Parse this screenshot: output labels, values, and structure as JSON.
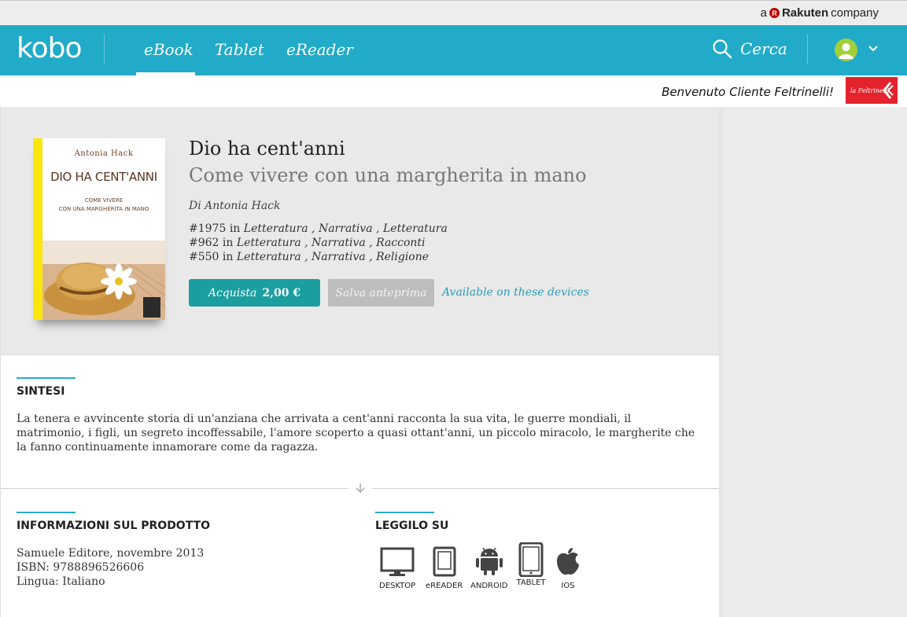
{
  "header": {
    "rakuten_prefix": "a",
    "rakuten_brand": "Rakuten",
    "rakuten_suffix": "company"
  },
  "nav": {
    "logo": "kobo",
    "tabs": [
      {
        "label": "eBook",
        "active": true
      },
      {
        "label": "Tablet",
        "active": false
      },
      {
        "label": "eReader",
        "active": false
      }
    ],
    "search_label": "Cerca",
    "accent_color": "#21abc8"
  },
  "welcome": {
    "text": "Benvenuto Cliente Feltrinelli!",
    "partner_logo_text": "la Feltrinelli"
  },
  "book": {
    "cover": {
      "author": "Antonia Hack",
      "title": "DIO HA CENT'ANNI",
      "subtitle_line1": "COME VIVERE",
      "subtitle_line2": "CON UNA MARGHERITA IN MANO"
    },
    "title": "Dio ha cent'anni",
    "subtitle": "Come vivere con una margherita in mano",
    "author_line": "Di Antonia Hack",
    "ranks": [
      {
        "rank": "#1975",
        "in": "in",
        "path": "Letteratura , Narrativa , Letteratura"
      },
      {
        "rank": "#962",
        "in": "in",
        "path": "Letteratura , Narrativa , Racconti"
      },
      {
        "rank": "#550",
        "in": "in",
        "path": "Letteratura , Narrativa , Religione"
      }
    ],
    "buy_label": "Acquista",
    "price": "2,00 €",
    "preview_label": "Salva anteprima",
    "devices_link": "Available on these devices"
  },
  "synopsis": {
    "heading": "SINTESI",
    "text": "La tenera e avvincente storia di un'anziana che arrivata a cent'anni racconta la sua vita, le guerre mondiali, il matrimonio, i figli, un segreto incoffessabile, l'amore scoperto a quasi ottant'anni, un piccolo miracolo, le margherite che la fanno continuamente innamorare come da ragazza."
  },
  "product_info": {
    "heading": "INFORMAZIONI SUL PRODOTTO",
    "publisher": "Samuele Editore, novembre 2013",
    "isbn": "ISBN:  9788896526606",
    "language": "Lingua:  Italiano"
  },
  "read_on": {
    "heading": "LEGGILO SU",
    "devices": [
      {
        "label": "DESKTOP",
        "icon": "desktop-icon"
      },
      {
        "label": "eREADER",
        "icon": "ereader-icon"
      },
      {
        "label": "ANDROID",
        "icon": "android-icon"
      },
      {
        "label": "TABLET",
        "icon": "tablet-icon"
      },
      {
        "label": "IOS",
        "icon": "apple-icon"
      }
    ]
  }
}
